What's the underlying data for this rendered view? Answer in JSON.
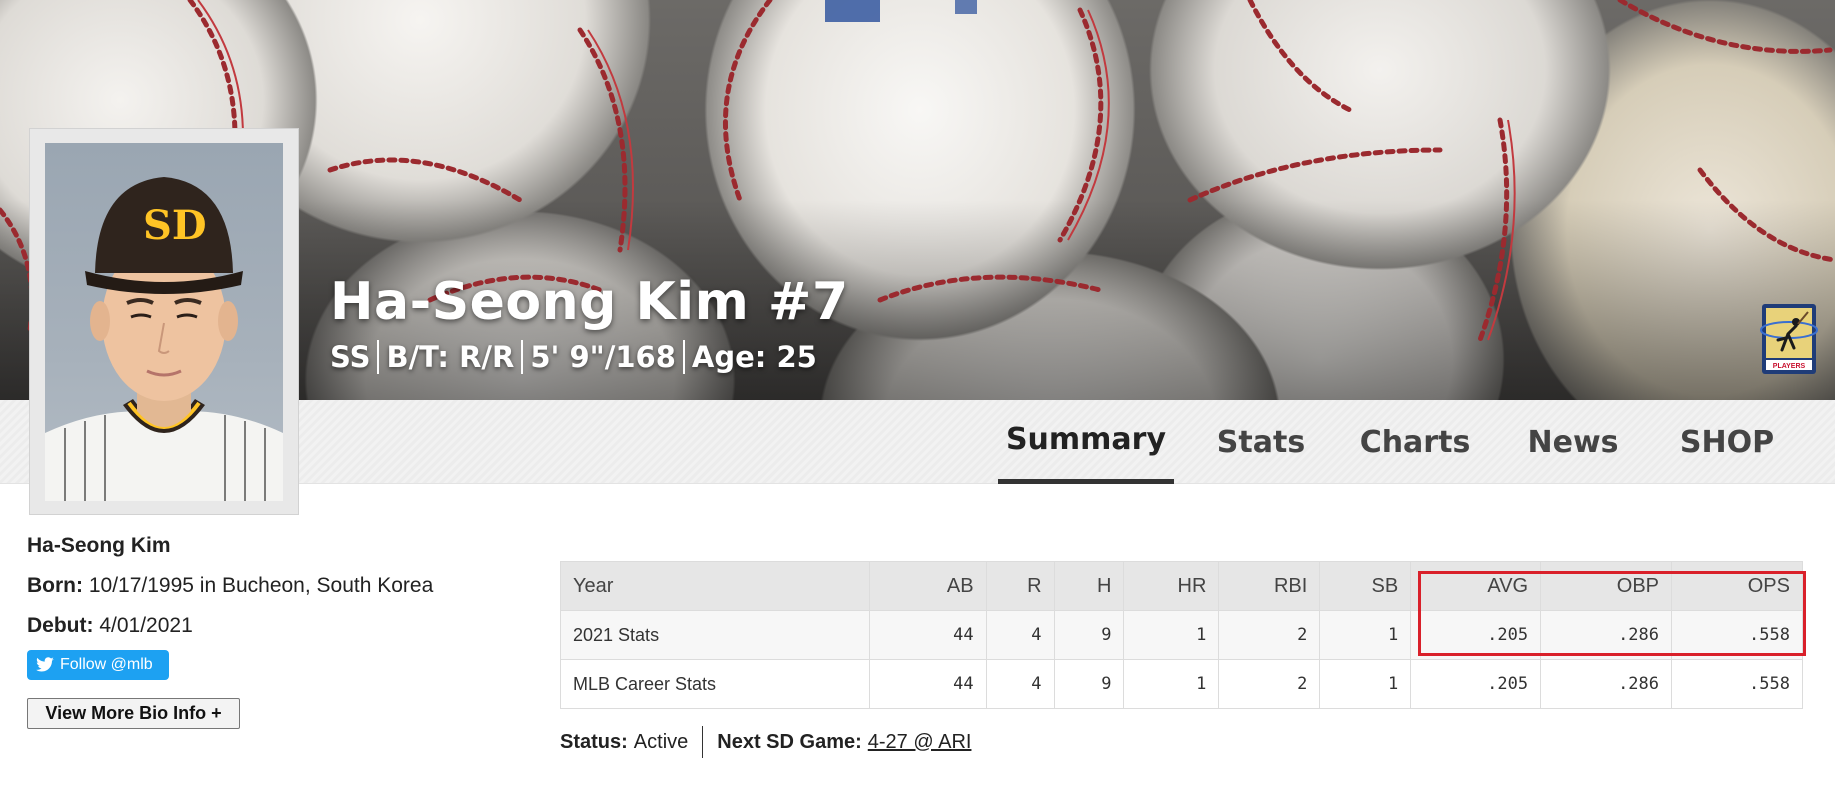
{
  "player": {
    "hero_name": "Ha-Seong Kim #7",
    "position": "SS",
    "bats_throws": "B/T: R/R",
    "height_weight": "5' 9\"/168",
    "age": "Age: 25"
  },
  "nav": {
    "tabs": [
      {
        "label": "Summary",
        "active": true
      },
      {
        "label": "Stats"
      },
      {
        "label": "Charts"
      },
      {
        "label": "News"
      },
      {
        "label": "SHOP"
      }
    ]
  },
  "bio": {
    "name": "Ha-Seong Kim",
    "born_label": "Born:",
    "born_value": "10/17/1995 in Bucheon, South Korea",
    "debut_label": "Debut:",
    "debut_value": "4/01/2021",
    "follow_label": "Follow @mlb",
    "more_label": "View More Bio Info +"
  },
  "stats": {
    "headers": [
      "Year",
      "AB",
      "R",
      "H",
      "HR",
      "RBI",
      "SB",
      "AVG",
      "OBP",
      "OPS"
    ],
    "rows": [
      [
        "2021 Stats",
        "44",
        "4",
        "9",
        "1",
        "2",
        "1",
        ".205",
        ".286",
        ".558"
      ],
      [
        "MLB Career Stats",
        "44",
        "4",
        "9",
        "1",
        "2",
        "1",
        ".205",
        ".286",
        ".558"
      ]
    ]
  },
  "status": {
    "status_label": "Status:",
    "status_value": "Active",
    "next_game_label": "Next SD Game:",
    "next_game_value": "4-27 @ ARI"
  },
  "colors": {
    "highlight": "#d9202a",
    "twitter": "#1da1f2",
    "padres_brown": "#2f241d",
    "padres_gold": "#ffc425"
  },
  "icons": {
    "twitter": "bird-icon",
    "players_logo": "mlb-players-logo"
  },
  "logo_text": {
    "players": "PLAYERS"
  }
}
